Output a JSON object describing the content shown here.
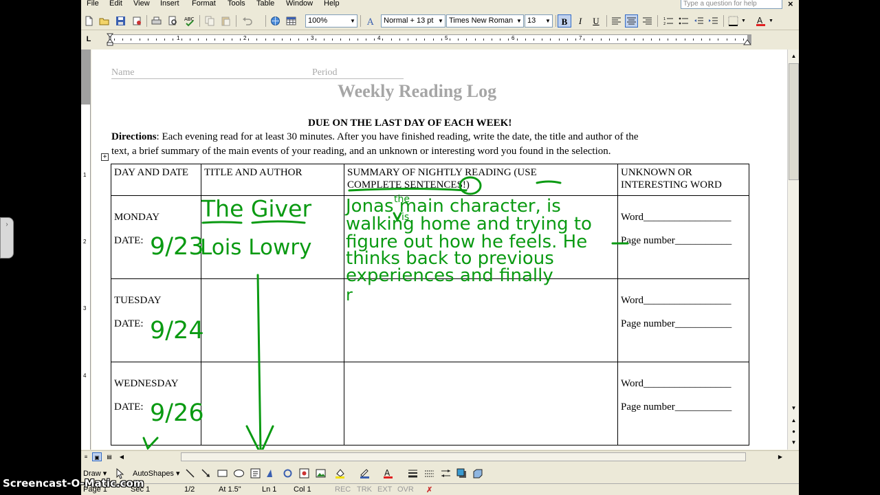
{
  "menu": [
    "File",
    "Edit",
    "View",
    "Insert",
    "Format",
    "Tools",
    "Table",
    "Window",
    "Help"
  ],
  "help_placeholder": "Type a question for help",
  "toolbar": {
    "zoom": "100%",
    "style": "Normal + 13 pt",
    "font": "Times New Roman",
    "font_size": "13",
    "bold": "B",
    "italic": "I",
    "underline": "U"
  },
  "ruler_numbers": [
    "1",
    "2",
    "3",
    "4",
    "5",
    "6",
    "7"
  ],
  "vruler_numbers": [
    "1",
    "2",
    "3",
    "4"
  ],
  "document": {
    "name_label": "Name",
    "period_label": "Period",
    "title": "Weekly Reading Log",
    "due": "DUE ON THE LAST DAY OF EACH WEEK!",
    "directions_label": "Directions",
    "directions_line1": ": Each evening read for at least 30 minutes. After you have finished reading, write the date, the title and author of the",
    "directions_line2": "text, a brief summary of the main events of your reading, and an unknown or interesting word you found in the selection.",
    "headers": {
      "day": "DAY AND DATE",
      "title": "TITLE AND AUTHOR",
      "summary_1": "SUMMARY OF NIGHTLY READING (USE",
      "summary_2": "COMPLETE SENTENCES!)",
      "word_1": "UNKNOWN OR",
      "word_2": "INTERESTING  WORD"
    },
    "rows": [
      {
        "day": "MONDAY",
        "date": "DATE:",
        "word": "Word_________________",
        "page": "Page number___________"
      },
      {
        "day": "TUESDAY",
        "date": "DATE:",
        "word": "Word_________________",
        "page": "Page number___________"
      },
      {
        "day": "WEDNESDAY",
        "date": "DATE:",
        "word": "Word_________________",
        "page": "Page number___________"
      }
    ]
  },
  "handwriting": {
    "book_title": "The Giver",
    "author": "Lois Lowry",
    "date_mon": "9/23",
    "date_tue": "9/24",
    "date_wed": "9/26",
    "summary_lines": [
      "Jonas main character, is",
      "walking home and trying to",
      "figure out how he feels. He",
      "thinks back to previous",
      "experiences and finally"
    ],
    "insert_the": "the",
    "insert_is": "is",
    "stray_mark": "r",
    "color": "#0a9a12"
  },
  "drawbar": {
    "draw": "Draw ▾",
    "autoshapes": "AutoShapes ▾"
  },
  "status": {
    "page": "Page 1",
    "sec": "Sec 1",
    "pos": "1/2",
    "at": "At 1.5\"",
    "ln": "Ln 1",
    "col": "Col 1",
    "rec": "REC",
    "trk": "TRK",
    "ext": "EXT",
    "ovr": "OVR"
  },
  "watermark": "Screencast-O-Matic.com"
}
